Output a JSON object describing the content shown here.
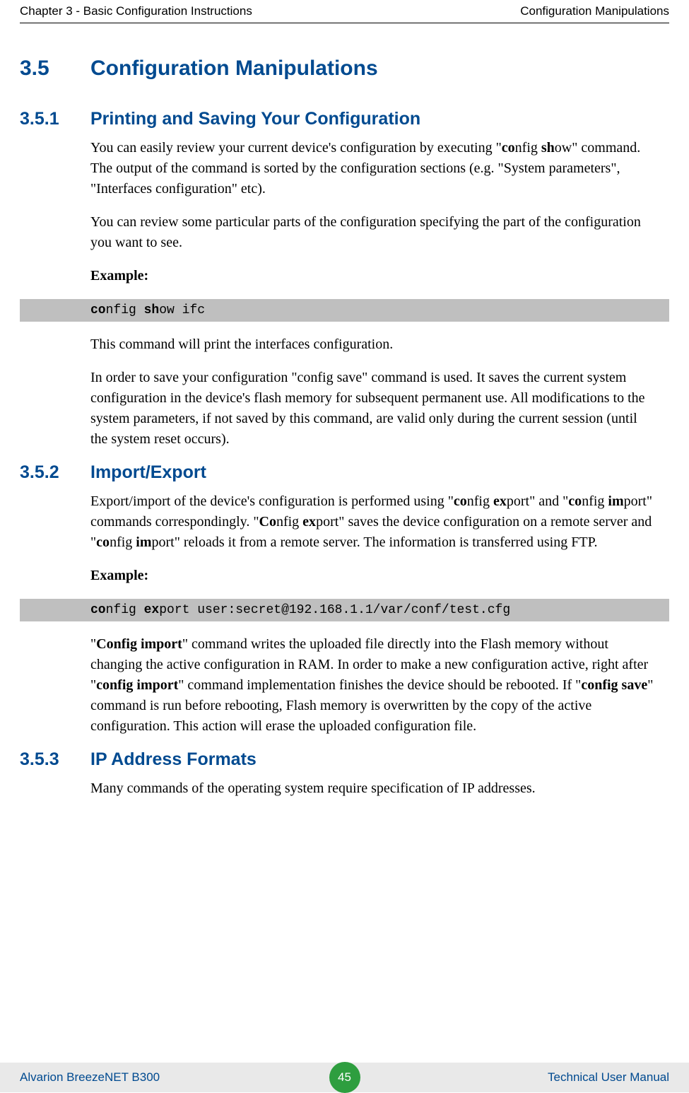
{
  "header": {
    "left": "Chapter 3 - Basic Configuration Instructions",
    "right": "Configuration Manipulations"
  },
  "sections": {
    "s35": {
      "num": "3.5",
      "title": "Configuration Manipulations"
    },
    "s351": {
      "num": "3.5.1",
      "title": "Printing and Saving Your Configuration"
    },
    "s352": {
      "num": "3.5.2",
      "title": "Import/Export"
    },
    "s353": {
      "num": "3.5.3",
      "title": "IP Address Formats"
    }
  },
  "paras": {
    "p1a": "You can easily review your current device's configuration by executing \"",
    "p1b": "co",
    "p1c": "nfig ",
    "p1d": "sh",
    "p1e": "ow\" command. The output of the command is sorted by the configuration sections (e.g. \"System parameters\", \"Interfaces configuration\" etc).",
    "p2": "You can review some particular parts of the configuration specifying the part of the configuration you want to see.",
    "ex": "Example:",
    "p3": "This command will print the interfaces configuration.",
    "p4": "In order to save your configuration \"config save\" command is used. It saves the current system configuration in the device's flash memory for subsequent permanent use. All modifications to the system parameters, if not saved by this command, are valid only during the current session (until the system reset occurs).",
    "p5a": "Export/import of the device's configuration is performed using \"",
    "p5b": "co",
    "p5c": "nfig ",
    "p5d": "ex",
    "p5e": "port\" and \"",
    "p5f": "co",
    "p5g": "nfig ",
    "p5h": "im",
    "p5i": "port\" commands correspondingly. \"",
    "p5j": "Co",
    "p5k": "nfig ",
    "p5l": "ex",
    "p5m": "port\" saves the device configuration on a remote server and \"",
    "p5n": "co",
    "p5o": "nfig ",
    "p5p": "im",
    "p5q": "port\" reloads it from a remote server. The information is transferred using FTP.",
    "p6a": "\"",
    "p6b": "Config import",
    "p6c": "\" command writes the uploaded file directly into the Flash memory without changing the active configuration in RAM. In order to make a new configuration active, right after \"",
    "p6d": "config import",
    "p6e": "\" command implementation finishes the device should be rebooted. If \"",
    "p6f": "config save",
    "p6g": "\" command is run before rebooting, Flash memory is overwritten by the copy of the active configuration. This action will erase the uploaded configuration file.",
    "p7": "Many commands of the operating system require specification of IP addresses."
  },
  "code": {
    "c1a": "co",
    "c1b": "nfig ",
    "c1c": "sh",
    "c1d": "ow ifc",
    "c2a": "co",
    "c2b": "nfig ",
    "c2c": "ex",
    "c2d": "port user:secret@192.168.1.1/var/conf/test.cfg"
  },
  "footer": {
    "left": "Alvarion BreezeNET B300",
    "page": "45",
    "right": "Technical User Manual"
  }
}
